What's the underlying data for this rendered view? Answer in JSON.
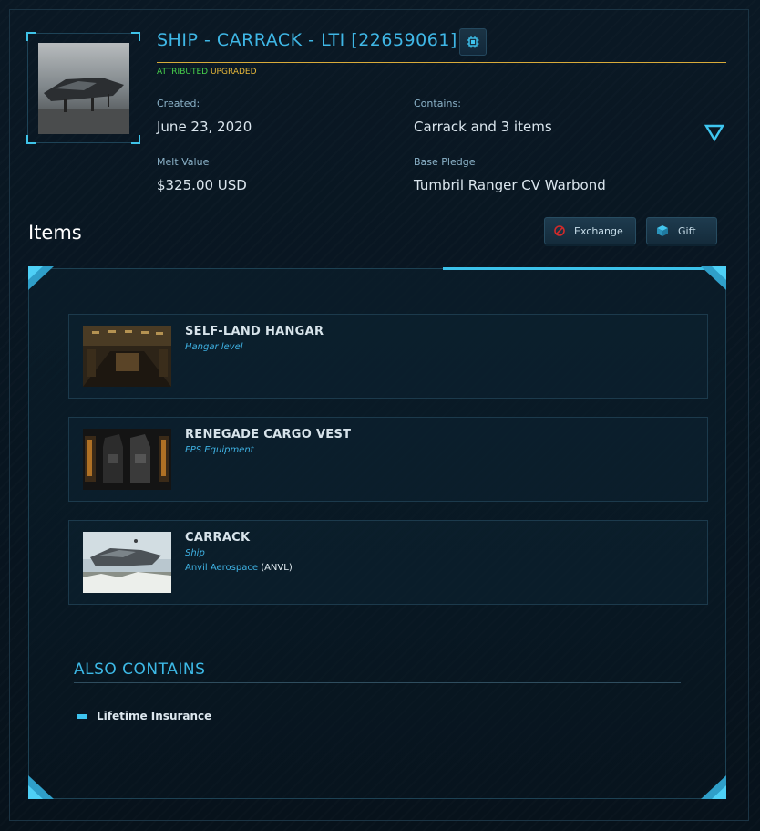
{
  "pledge": {
    "title": "SHIP - CARRACK - LTI [22659061]",
    "tags": {
      "attributed": "ATTRIBUTED",
      "upgraded": "UPGRADED"
    },
    "created_label": "Created:",
    "created_value": "June 23, 2020",
    "contains_label": "Contains:",
    "contains_value": "Carrack and 3 items",
    "melt_label": "Melt Value",
    "melt_value": "$325.00 USD",
    "base_label": "Base Pledge",
    "base_value": "Tumbril Ranger CV Warbond"
  },
  "items_section": {
    "heading": "Items",
    "exchange_label": "Exchange",
    "gift_label": "Gift"
  },
  "items": [
    {
      "name": "SELF-LAND HANGAR",
      "type": "Hangar level"
    },
    {
      "name": "RENEGADE CARGO VEST",
      "type": "FPS Equipment"
    },
    {
      "name": "CARRACK",
      "type": "Ship",
      "manufacturer": "Anvil Aerospace",
      "manufacturer_code": "(ANVL)"
    }
  ],
  "also_contains": {
    "heading": "ALSO CONTAINS",
    "items": [
      "Lifetime Insurance"
    ]
  },
  "colors": {
    "accent": "#3fb7e6",
    "title_rule": "#d8ab3a",
    "attributed": "#47d14c",
    "upgraded": "#e6b73a",
    "exchange_icon": "#d32a2a"
  },
  "icons": {
    "chip": "chip-icon",
    "expand": "triangle-down-icon",
    "exchange": "no-entry-icon",
    "gift": "cube-icon",
    "bullet": "dash-bullet-icon"
  }
}
